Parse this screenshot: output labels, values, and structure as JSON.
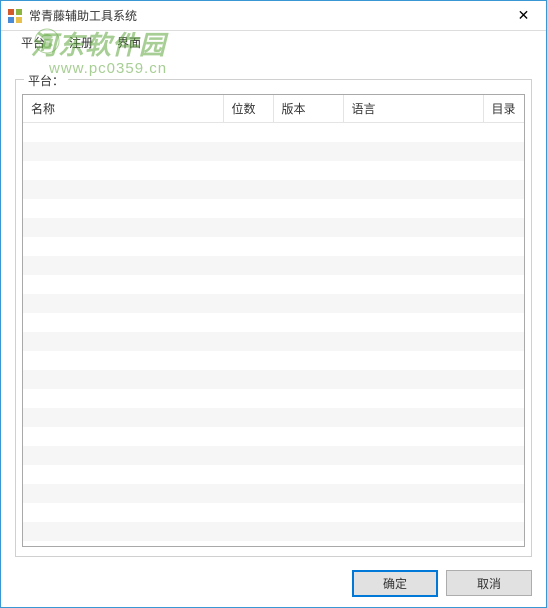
{
  "window": {
    "title": "常青藤辅助工具系统"
  },
  "menu": {
    "platform": "平台",
    "register": "注册",
    "interface": "界面"
  },
  "watermark": {
    "main": "河东软件园",
    "sub": "www.pc0359.cn"
  },
  "group": {
    "title": "平台："
  },
  "table": {
    "headers": {
      "name": "名称",
      "bits": "位数",
      "version": "版本",
      "language": "语言",
      "directory": "目录"
    },
    "rows": []
  },
  "buttons": {
    "ok": "确定",
    "cancel": "取消"
  }
}
